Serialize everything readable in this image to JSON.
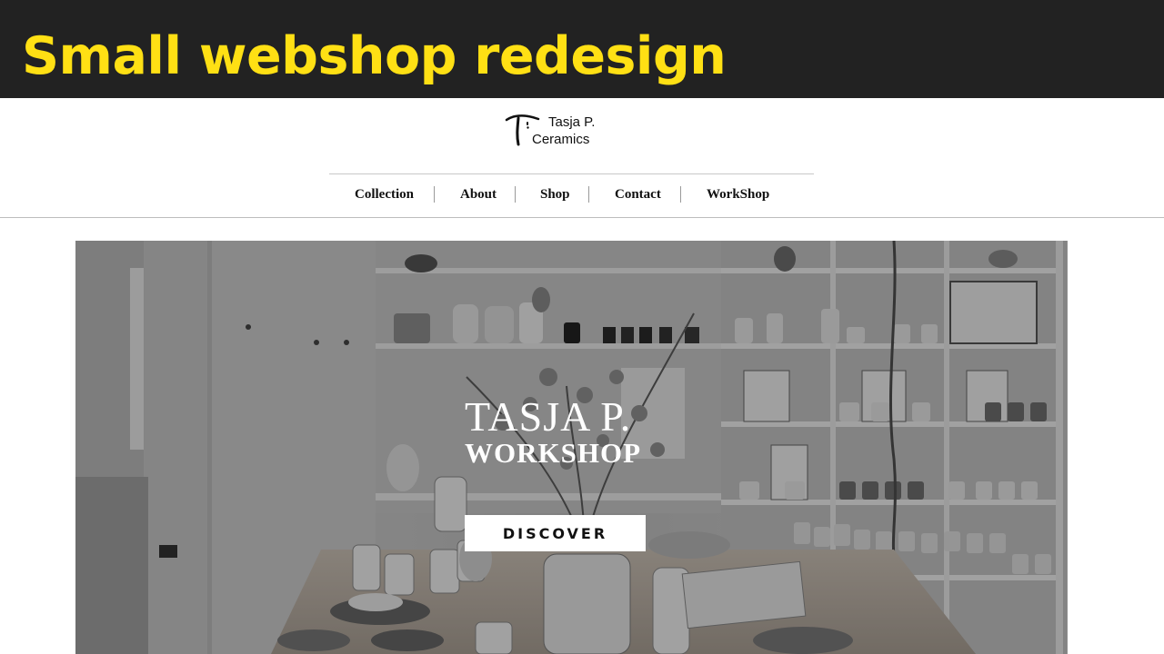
{
  "banner": {
    "title": "Small webshop redesign",
    "color": "#FFE014"
  },
  "logo": {
    "icon": "tp-monogram-icon",
    "line1": "Tasja P.",
    "line2": "Ceramics"
  },
  "nav": {
    "items": [
      "Collection",
      "About",
      "Shop",
      "Contact",
      "WorkShop"
    ]
  },
  "hero": {
    "title_line1": "TASJA P.",
    "title_line2": "WORKSHOP",
    "button_label": "DISCOVER"
  }
}
